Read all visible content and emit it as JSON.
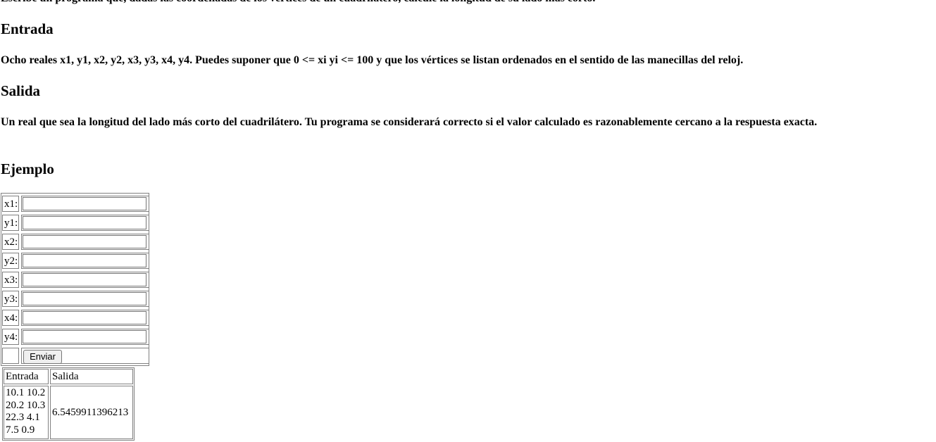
{
  "intro": "Escribe un programa que, dadas las coordenadas de los vértices de un cuadrilátero, calcule la longitud de su lado más corto.",
  "sections": {
    "entrada": {
      "heading": "Entrada",
      "text": "Ocho reales x1, y1, x2, y2, x3, y3, x4, y4. Puedes suponer que 0 <= xi yi <= 100 y que los vértices se listan ordenados en el sentido de las manecillas del reloj."
    },
    "salida": {
      "heading": "Salida",
      "text": "Un real que sea la longitud del lado más corto del cuadrilátero. Tu programa se considerará correcto si el valor calculado es razonablemente cercano a la respuesta exacta."
    },
    "ejemplo": {
      "heading": "Ejemplo"
    }
  },
  "form": {
    "fields": [
      {
        "label": "x1:",
        "value": ""
      },
      {
        "label": "y1:",
        "value": ""
      },
      {
        "label": "x2:",
        "value": ""
      },
      {
        "label": "y2:",
        "value": ""
      },
      {
        "label": "x3:",
        "value": ""
      },
      {
        "label": "y3:",
        "value": ""
      },
      {
        "label": "x4:",
        "value": ""
      },
      {
        "label": "y4:",
        "value": ""
      }
    ],
    "submit_label": "Enviar"
  },
  "example": {
    "headers": [
      "Entrada",
      "Salida"
    ],
    "input_lines": [
      "10.1 10.2",
      "20.2 10.3",
      "22.3 4.1",
      "7.5 0.9"
    ],
    "output": "6.5459911396213"
  }
}
